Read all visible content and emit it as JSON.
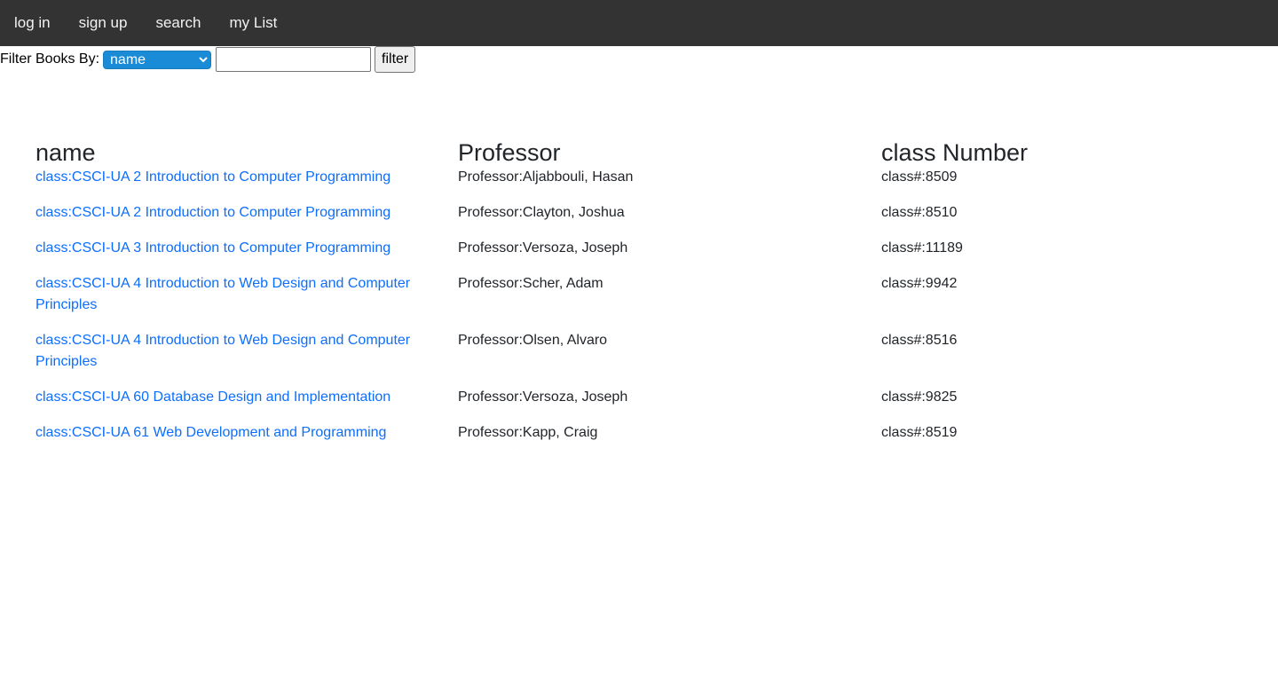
{
  "nav": {
    "items": [
      {
        "label": "log in"
      },
      {
        "label": "sign up"
      },
      {
        "label": "search"
      },
      {
        "label": "my List"
      }
    ]
  },
  "filter": {
    "label": "Filter Books By:",
    "select_value": "name",
    "input_value": "",
    "button_label": "filter"
  },
  "table": {
    "headers": [
      "name",
      "Professor",
      "class Number"
    ],
    "rows": [
      {
        "name": "class:CSCI-UA 2 Introduction to Computer Programming",
        "professor": "Professor:Aljabbouli, Hasan",
        "class_number": "class#:8509"
      },
      {
        "name": "class:CSCI-UA 2 Introduction to Computer Programming",
        "professor": "Professor:Clayton, Joshua",
        "class_number": "class#:8510"
      },
      {
        "name": "class:CSCI-UA 3 Introduction to Computer Programming",
        "professor": "Professor:Versoza, Joseph",
        "class_number": "class#:11189"
      },
      {
        "name": "class:CSCI-UA 4 Introduction to Web Design and Computer Principles",
        "professor": "Professor:Scher, Adam",
        "class_number": "class#:9942"
      },
      {
        "name": "class:CSCI-UA 4 Introduction to Web Design and Computer Principles",
        "professor": "Professor:Olsen, Alvaro",
        "class_number": "class#:8516"
      },
      {
        "name": "class:CSCI-UA 60 Database Design and Implementation",
        "professor": "Professor:Versoza, Joseph",
        "class_number": "class#:9825"
      },
      {
        "name": "class:CSCI-UA 61 Web Development and Programming",
        "professor": "Professor:Kapp, Craig",
        "class_number": "class#:8519"
      }
    ]
  },
  "colors": {
    "nav_bg": "#333333",
    "link": "#0d6efd",
    "select_bg": "#1a8bd6"
  }
}
